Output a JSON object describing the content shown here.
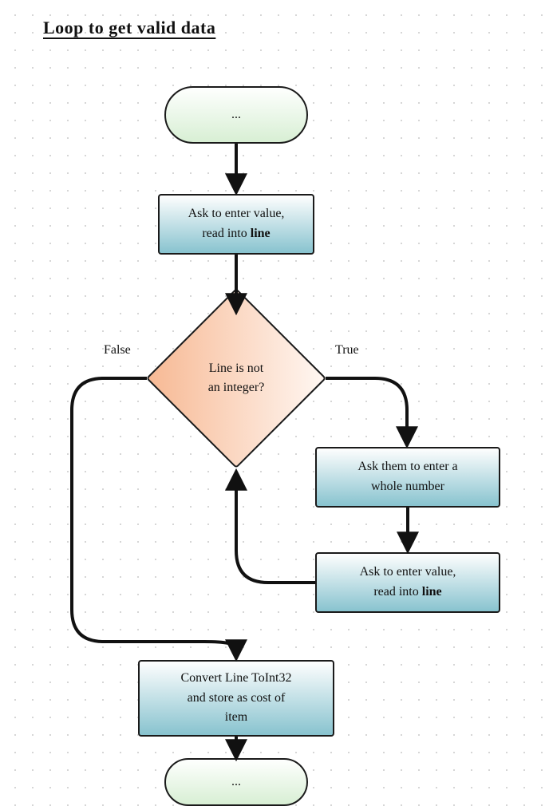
{
  "title": "Loop to get valid data",
  "nodes": {
    "start": "...",
    "ask1_a": "Ask to enter value,",
    "ask1_b": "read into ",
    "ask1_c": "line",
    "decision_a": "Line is not",
    "decision_b": "an integer?",
    "askwhole_a": "Ask them to enter a",
    "askwhole_b": "whole number",
    "ask2_a": "Ask to enter value,",
    "ask2_b": "read into ",
    "ask2_c": "line",
    "convert_a": "Convert Line ToInt32",
    "convert_b": "and store as cost of",
    "convert_c": "item",
    "end": "..."
  },
  "labels": {
    "false": "False",
    "true": "True"
  }
}
